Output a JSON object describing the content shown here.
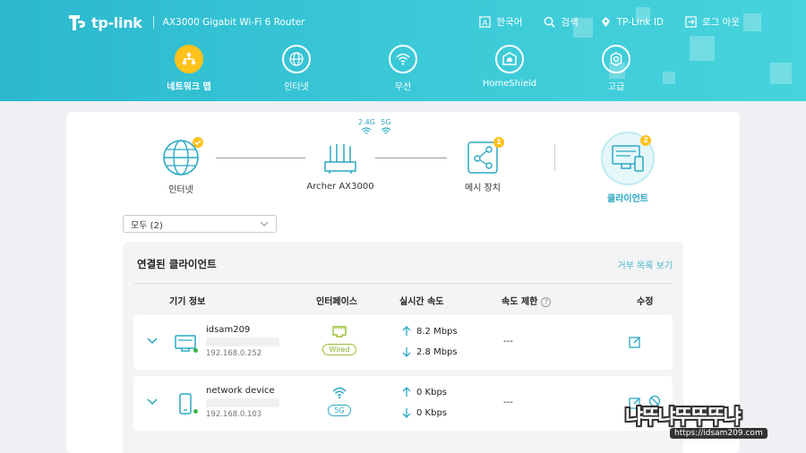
{
  "header": {
    "brand": "tp-link",
    "model": "AX3000 Gigabit Wi-Fi 6 Router",
    "top_links": [
      {
        "label": "한국어",
        "icon": "language-icon"
      },
      {
        "label": "검색",
        "icon": "search-icon"
      },
      {
        "label": "TP-Link ID",
        "icon": "tplink-id-icon"
      },
      {
        "label": "로그 아웃",
        "icon": "logout-icon"
      }
    ],
    "nav": [
      {
        "label": "네트워크 맵",
        "icon": "network-map-icon",
        "active": true
      },
      {
        "label": "인터넷",
        "icon": "globe-icon",
        "active": false
      },
      {
        "label": "무선",
        "icon": "wifi-icon",
        "active": false
      },
      {
        "label": "HomeShield",
        "icon": "homeshield-icon",
        "active": false
      },
      {
        "label": "고급",
        "icon": "gear-icon",
        "active": false
      }
    ]
  },
  "topology": {
    "internet": {
      "label": "인터넷"
    },
    "router": {
      "label": "Archer AX3000",
      "band_24": "2.4G",
      "band_5": "5G"
    },
    "mesh": {
      "label": "메시 장치",
      "count": "1"
    },
    "clients": {
      "label": "클라이언트",
      "count": "2"
    }
  },
  "filter": {
    "value": "모두 (2)"
  },
  "clients_panel": {
    "title": "연결된 클라이언트",
    "blocklist_link": "거부 목록 보기",
    "columns": {
      "device": "기기 정보",
      "interface": "인터페이스",
      "speed": "실시간 속도",
      "limit": "속도 제한",
      "edit": "수정"
    },
    "rows": [
      {
        "name": "idsam209",
        "ip": "192.168.0.252",
        "type": "desktop",
        "interface": "Wired",
        "up": "8.2 Mbps",
        "down": "2.8 Mbps",
        "limit": "---"
      },
      {
        "name": "network device",
        "ip": "192.168.0.103",
        "type": "phone",
        "interface": "5G",
        "up": "0 Kbps",
        "down": "0 Kbps",
        "limit": "---"
      }
    ]
  },
  "watermark": {
    "text": "냐뚜냐뚜뚜뚜냐",
    "url": "https://idsam209.com"
  },
  "colors": {
    "header": "#2bb8cf",
    "accent": "#ffc21a",
    "link": "#4ab7cd",
    "online": "#3bb54a",
    "wired": "#9bc033"
  }
}
